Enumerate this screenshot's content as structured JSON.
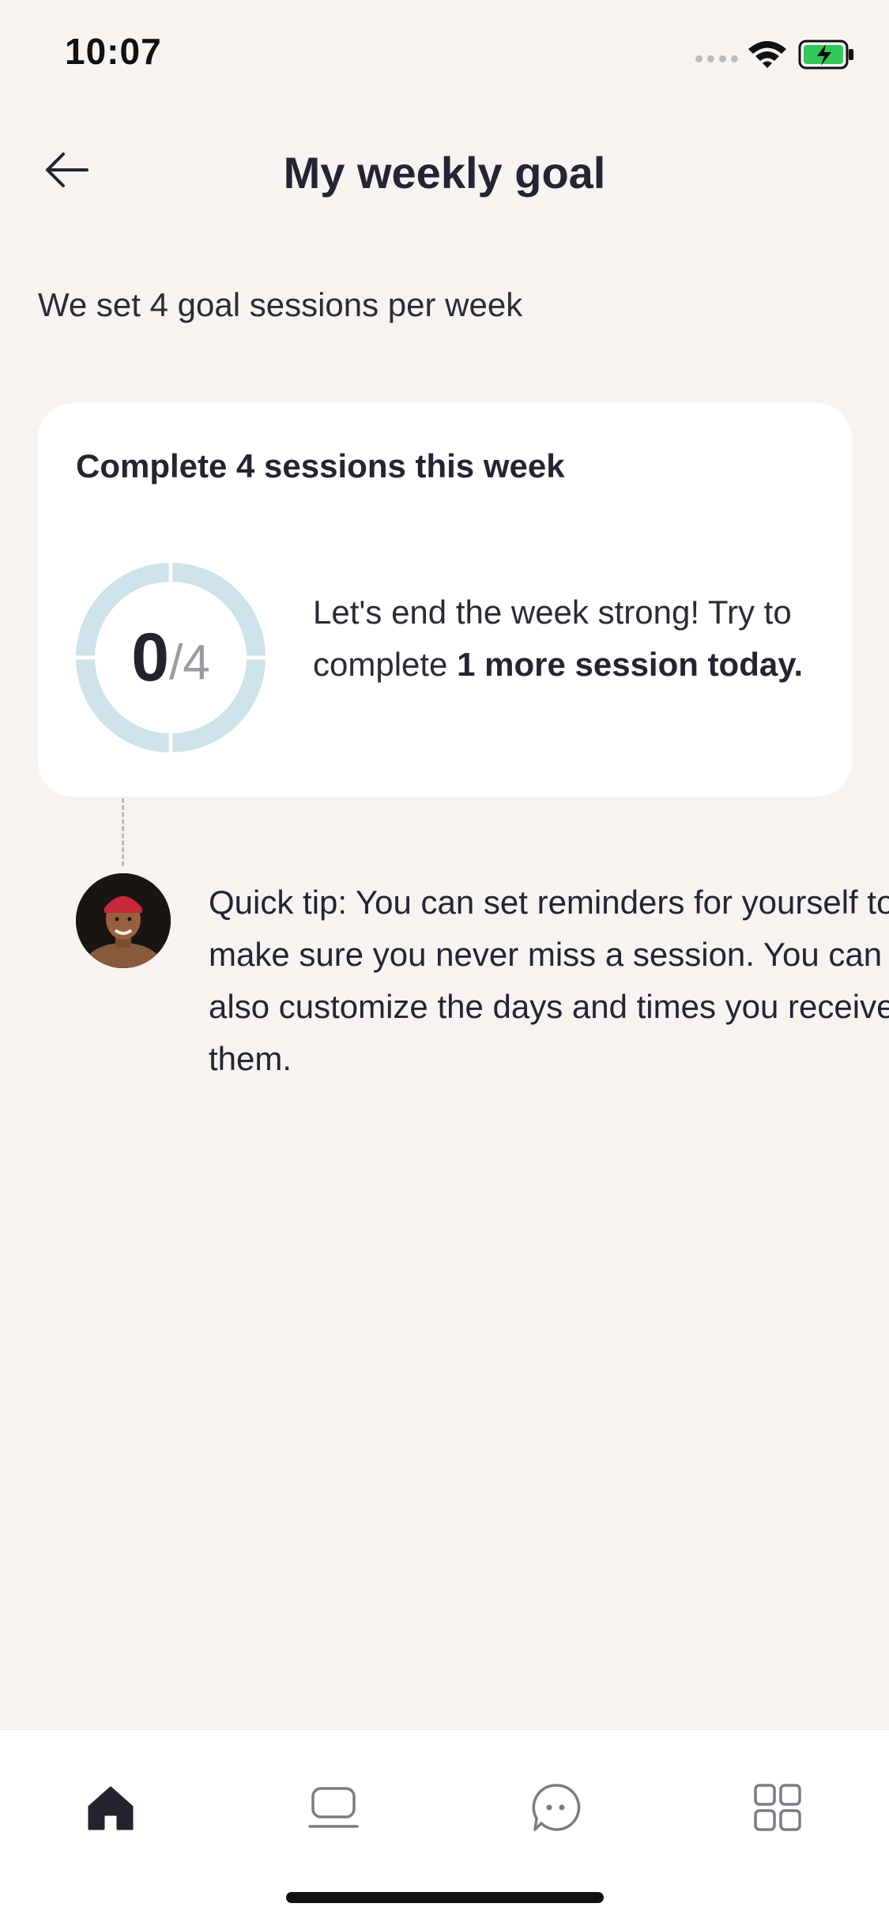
{
  "status_bar": {
    "time": "10:07",
    "signal_icon": "signal-dots-icon",
    "wifi_icon": "wifi-icon",
    "battery_icon": "battery-charging-icon",
    "battery_color": "#34c759"
  },
  "header": {
    "back_icon": "arrow-left-icon",
    "title": "My weekly goal"
  },
  "subtitle": "We set 4 goal sessions per week",
  "goal_card": {
    "title": "Complete 4 sessions this week",
    "progress": {
      "completed": "0",
      "separator": "/",
      "total": "4",
      "fraction": 0,
      "track_color": "#cfe3ea"
    },
    "message_prefix": "Let's end the week strong! Try to complete ",
    "message_bold": "1 more session today."
  },
  "tip": {
    "avatar_icon": "coach-avatar",
    "text": "Quick tip: You can set reminders for yourself to make sure you never miss a session. You can also customize the days and times you receive them."
  },
  "tab_bar": {
    "tabs": [
      {
        "icon": "home-icon",
        "active": true
      },
      {
        "icon": "laptop-icon",
        "active": false
      },
      {
        "icon": "chat-bubble-icon",
        "active": false
      },
      {
        "icon": "grid-icon",
        "active": false
      }
    ],
    "active_color": "#23232f",
    "inactive_color": "#7b7b86"
  }
}
